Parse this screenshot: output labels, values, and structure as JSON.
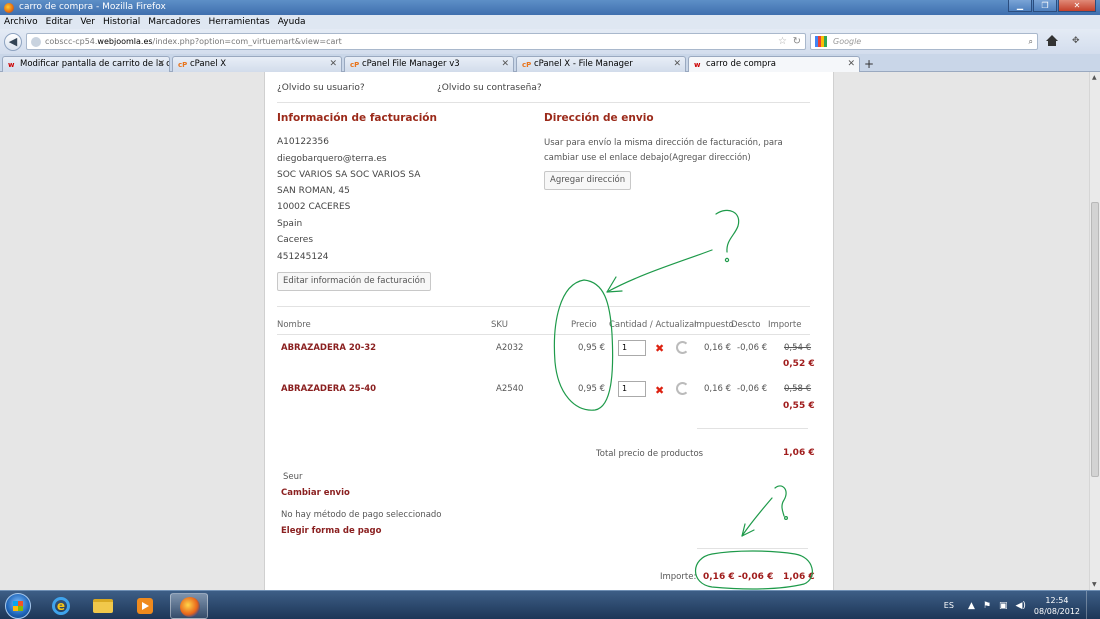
{
  "window": {
    "title": "carro de compra - Mozilla Firefox"
  },
  "menu": [
    "Archivo",
    "Editar",
    "Ver",
    "Historial",
    "Marcadores",
    "Herramientas",
    "Ayuda"
  ],
  "nav": {
    "url_prefix": "cobscc-cp54.",
    "url_domain": "webjoomla.es",
    "url_path": "/index.php?option=com_virtuemart&view=cart",
    "search_engine": "Google",
    "search_placeholder": "Google"
  },
  "tabs": [
    {
      "label": "Modificar pantalla de carrito de la co...",
      "icon": "w"
    },
    {
      "label": "cPanel X",
      "icon": "cP"
    },
    {
      "label": "cPanel File Manager v3",
      "icon": "cP"
    },
    {
      "label": "cPanel X - File Manager",
      "icon": "cP"
    },
    {
      "label": "carro de compra",
      "icon": "w"
    }
  ],
  "login": {
    "forgot_user": "¿Olvido su usuario?",
    "forgot_pass": "¿Olvido su contraseña?"
  },
  "billing": {
    "title": "Información de facturación",
    "lines": [
      "A10122356",
      "diegobarquero@terra.es",
      "SOC VARIOS SA SOC VARIOS SA",
      "SAN ROMAN, 45",
      "10002 CACERES",
      "Spain",
      "Caceres",
      "451245124"
    ],
    "edit_button": "Editar información de facturación"
  },
  "shipping": {
    "title": "Dirección de envio",
    "note": "Usar para envío la misma dirección de facturación, para cambiar use el enlace debajo(Agregar dirección)",
    "add_button": "Agregar dirección"
  },
  "cart": {
    "headers": {
      "name": "Nombre",
      "sku": "SKU",
      "price": "Precio",
      "qty": "Cantidad / Actualizar",
      "tax": "Impuesto",
      "discount": "Descto",
      "amount": "Importe"
    },
    "rows": [
      {
        "name": "ABRAZADERA 20-32",
        "sku": "A2032",
        "price": "0,95 €",
        "qty": "1",
        "tax": "0,16 €",
        "discount": "-0,06 €",
        "old": "0,54 €",
        "total": "0,52 €"
      },
      {
        "name": "ABRAZADERA 25-40",
        "sku": "A2540",
        "price": "0,95 €",
        "qty": "1",
        "tax": "0,16 €",
        "discount": "-0,06 €",
        "old": "0,58 €",
        "total": "0,55 €"
      }
    ],
    "products_total_label": "Total precio de productos",
    "products_total": "1,06 €",
    "shipper": "Seur",
    "change_shipping": "Cambiar envio",
    "no_payment": "No hay método de pago seleccionado",
    "choose_payment": "Elegir forma de pago",
    "summary_label": "Importe:",
    "summary_tax": "0,16 €",
    "summary_discount": "-0,06 €",
    "summary_total": "1,06 €"
  },
  "taskbar": {
    "lang": "ES",
    "time": "12:54",
    "date": "08/08/2012"
  },
  "colors": {
    "accent": "#9b2a1a",
    "annotation": "#1e9a4a"
  }
}
